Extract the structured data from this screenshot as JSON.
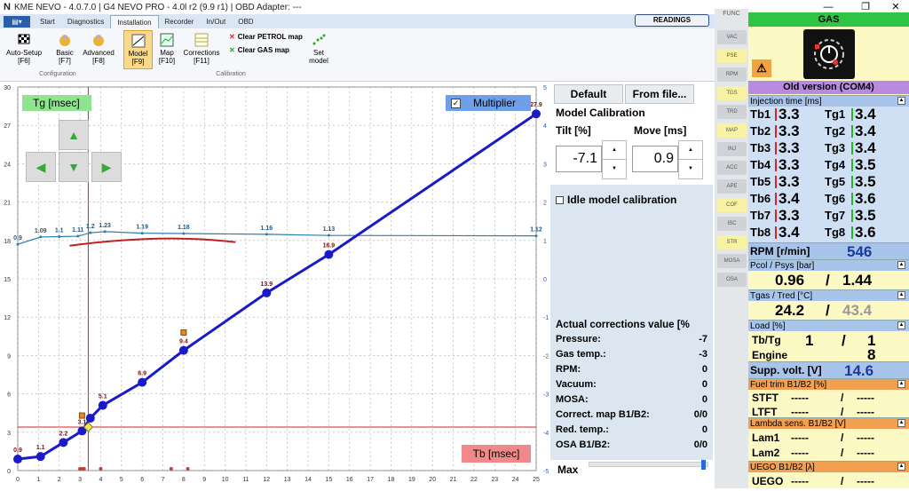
{
  "window": {
    "logo": "N",
    "title": "KME NEVO - 4.0.7.0  |  G4 NEVO PRO - 4.0l r2 (9.9 r1)  |  OBD Adapter: ---",
    "min": "—",
    "max": "❐",
    "close": "✕"
  },
  "tabs": [
    "Start",
    "Diagnostics",
    "Installation",
    "Recorder",
    "In/Out",
    "OBD"
  ],
  "readings_label": "READINGS",
  "ribbon": {
    "autosetup": "Auto-Setup\n[F6]",
    "basic": "Basic\n[F7]",
    "advanced": "Advanced\n[F8]",
    "model": "Model\n[F9]",
    "map": "Map\n[F10]",
    "corrections": "Corrections\n[F11]",
    "clear_petrol": "Clear PETROL map",
    "clear_gas": "Clear GAS map",
    "set_model": "Set\nmodel",
    "group_config": "Configuration",
    "group_calib": "Calibration"
  },
  "chart": {
    "tg_label": "Tg [msec]",
    "tb_label": "Tb [msec]",
    "multiplier": "Multiplier",
    "yticks": [
      "30",
      "27",
      "24",
      "21",
      "18",
      "15",
      "12",
      "9",
      "6",
      "3",
      "0"
    ],
    "xticks": [
      "0",
      "1",
      "2",
      "3",
      "4",
      "5",
      "6",
      "7",
      "8",
      "9",
      "10",
      "11",
      "12",
      "13",
      "14",
      "15",
      "16",
      "17",
      "18",
      "19",
      "20",
      "21",
      "22",
      "23",
      "24",
      "25"
    ],
    "rticks": [
      "5",
      "4",
      "3",
      "2",
      "1",
      "0",
      "-1",
      "-2",
      "-3",
      "-4",
      "-5"
    ]
  },
  "chart_data": {
    "type": "line",
    "xlabel": "Tb [msec]",
    "ylabel": "Tg [msec]",
    "xlim": [
      0,
      25
    ],
    "ylim": [
      0,
      30
    ],
    "y2lim": [
      -5,
      5
    ],
    "series": [
      {
        "name": "Tg [msec]",
        "color": "#1a1ac8",
        "x": [
          0,
          1.1,
          2.2,
          3.1,
          3.5,
          4.1,
          6,
          8,
          12,
          15,
          25
        ],
        "y": [
          0.9,
          1.1,
          2.2,
          3.1,
          4.1,
          5.1,
          6.9,
          9.4,
          13.9,
          16.9,
          27.9
        ],
        "labels": [
          "0.9",
          "1.1",
          "2.2",
          "3.1",
          "",
          "5.1",
          "6.9",
          "9.4",
          "13.9",
          "16.9",
          "27.9"
        ]
      },
      {
        "name": "Multiplier",
        "color": "#2c7fa8",
        "x": [
          0,
          1.1,
          2,
          2.9,
          3.5,
          4.2,
          6,
          8,
          12,
          15,
          25
        ],
        "y": [
          0.9,
          1.09,
          1.1,
          1.11,
          1.2,
          1.23,
          1.19,
          1.18,
          1.16,
          1.13,
          1.12
        ],
        "labels": [
          "0.9",
          "1.09",
          "1.1",
          "1.11",
          "1.2",
          "1.23",
          "1.19",
          "1.18",
          "1.16",
          "1.13",
          "1.12"
        ]
      }
    ]
  },
  "calib": {
    "default": "Default",
    "fromfile": "From file...",
    "title": "Model Calibration",
    "tilt_label": "Tilt [%]",
    "move_label": "Move [ms]",
    "tilt": "-7.1",
    "move": "0.9",
    "idle": "Idle model calibration"
  },
  "corrections": {
    "title": "Actual corrections value [%",
    "rows": [
      [
        "Pressure:",
        "-7"
      ],
      [
        "Gas temp.:",
        "-3"
      ],
      [
        "RPM:",
        "0"
      ],
      [
        "Vacuum:",
        "0"
      ],
      [
        "MOSA:",
        "0"
      ],
      [
        "Correct. map B1/B2:",
        "0/0"
      ],
      [
        "Red. temp.:",
        "0"
      ],
      [
        "OSA B1/B2:",
        "0/0"
      ]
    ],
    "max": "Max"
  },
  "func": {
    "title": "FUNC",
    "items": [
      "VAC",
      "PSE",
      "RPM",
      "TGS",
      "TRD",
      "MAP",
      "INJ",
      "ACC",
      "APE",
      "COF",
      "ISC",
      "STR",
      "MOSA",
      "OSA"
    ]
  },
  "gas": {
    "title": "GAS",
    "version": "Old version (COM4)",
    "inj_head": "Injection time [ms]",
    "tb": [
      [
        "Tb1",
        "3.3"
      ],
      [
        "Tb2",
        "3.3"
      ],
      [
        "Tb3",
        "3.3"
      ],
      [
        "Tb4",
        "3.3"
      ],
      [
        "Tb5",
        "3.3"
      ],
      [
        "Tb6",
        "3.4"
      ],
      [
        "Tb7",
        "3.3"
      ],
      [
        "Tb8",
        "3.4"
      ]
    ],
    "tg": [
      [
        "Tg1",
        "3.4"
      ],
      [
        "Tg2",
        "3.4"
      ],
      [
        "Tg3",
        "3.4"
      ],
      [
        "Tg4",
        "3.5"
      ],
      [
        "Tg5",
        "3.5"
      ],
      [
        "Tg6",
        "3.6"
      ],
      [
        "Tg7",
        "3.5"
      ],
      [
        "Tg8",
        "3.6"
      ]
    ],
    "rpm_label": "RPM [r/min]",
    "rpm": "546",
    "pcol_head": "Pcol / Psys [bar]",
    "pcol": "0.96",
    "psys": "1.44",
    "tgas_head": "Tgas / Tred [°C]",
    "tgas": "24.2",
    "tred": "43.4",
    "load_head": "Load [%]",
    "load_label": "Tb/Tg",
    "load_tb": "1",
    "load_tg": "1",
    "engine_label": "Engine",
    "engine": "8",
    "supp_label": "Supp. volt. [V]",
    "supp": "14.6",
    "fuel_head": "Fuel trim B1/B2 [%]",
    "stft": "STFT",
    "ltft": "LTFT",
    "dash": "-----",
    "lambda_head": "Lambda sens. B1/B2 [V]",
    "lam1": "Lam1",
    "lam2": "Lam2",
    "uego_head": "UEGO B1/B2 [λ]",
    "uego": "UEGO",
    "slash": "/"
  }
}
